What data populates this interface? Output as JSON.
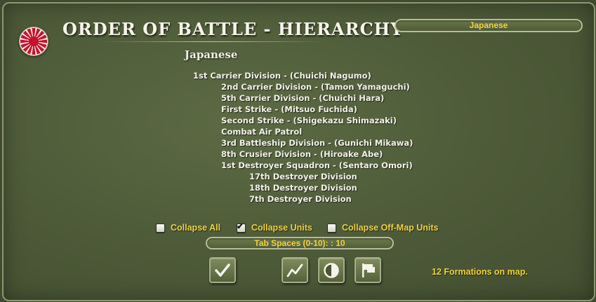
{
  "window": {
    "title": "ORDER OF BATTLE - HIERARCHY",
    "nation_selector": {
      "value": "Japanese"
    },
    "side_label": "Japanese"
  },
  "hierarchy": [
    {
      "label": "1st Carrier Division - (Chuichi Nagumo)",
      "level": 0
    },
    {
      "label": "2nd Carrier Division - (Tamon Yamaguchi)",
      "level": 1
    },
    {
      "label": "5th Carrier Division - (Chuichi Hara)",
      "level": 1
    },
    {
      "label": "First Strike - (Mitsuo Fuchida)",
      "level": 1
    },
    {
      "label": "Second Strike - (Shigekazu Shimazaki)",
      "level": 1
    },
    {
      "label": "Combat Air Patrol",
      "level": 1
    },
    {
      "label": "3rd Battleship Division - (Gunichi Mikawa)",
      "level": 1
    },
    {
      "label": "8th Crusier Division - (Hiroake Abe)",
      "level": 1
    },
    {
      "label": "1st Destroyer Squadron - (Sentaro Omori)",
      "level": 1
    },
    {
      "label": "17th Destroyer Division",
      "level": 2
    },
    {
      "label": "18th Destroyer Division",
      "level": 2
    },
    {
      "label": "7th Destroyer Division",
      "level": 2
    }
  ],
  "options": {
    "collapse_all": {
      "label": "Collapse All",
      "checked": false
    },
    "collapse_units": {
      "label": "Collapse Units",
      "checked": true
    },
    "collapse_offmap": {
      "label": "Collapse Off-Map Units",
      "checked": false
    }
  },
  "tab_spaces": {
    "label": "Tab Spaces (0-10): : 10"
  },
  "buttons": {
    "ok": {
      "icon": "checkmark-icon"
    },
    "line": {
      "icon": "line-graph-icon"
    },
    "contrast": {
      "icon": "contrast-icon"
    },
    "flag": {
      "icon": "flag-icon"
    }
  },
  "status": {
    "text": "12 Formations on map."
  },
  "colors": {
    "panel": "#4d5a38",
    "accent_text": "#f0d23e",
    "text": "#f3f1e8",
    "flag_red": "#c8102e"
  }
}
